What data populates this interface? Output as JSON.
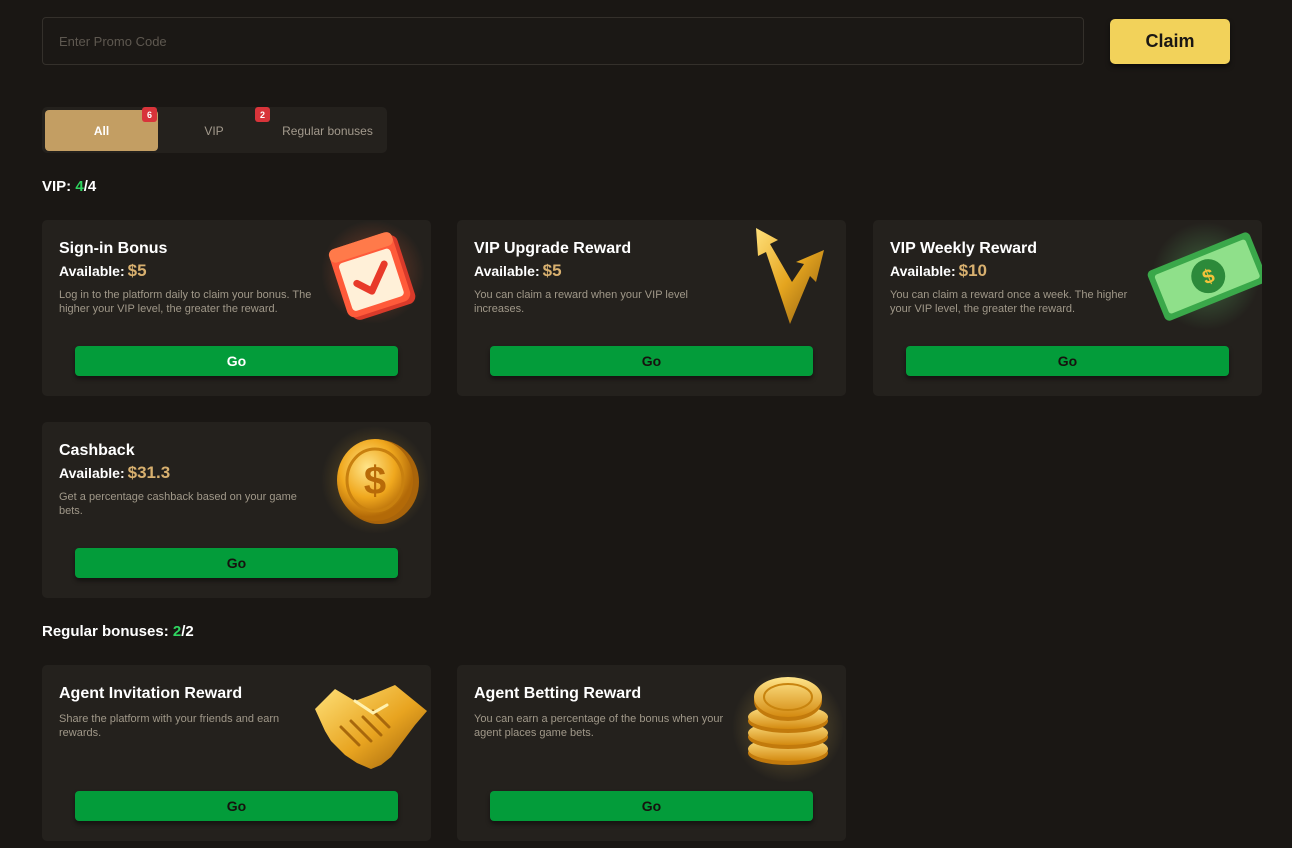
{
  "promo": {
    "placeholder": "Enter Promo Code",
    "claim_label": "Claim"
  },
  "tabs": [
    {
      "label": "All",
      "badge": "6",
      "active": true
    },
    {
      "label": "VIP",
      "badge": "2",
      "active": false
    },
    {
      "label": "Regular bonuses",
      "badge": "",
      "active": false
    }
  ],
  "vip_section": {
    "label": "VIP:",
    "count_done": "4",
    "count_total": "/4",
    "cards": [
      {
        "title": "Sign-in Bonus",
        "available_label": "Available:",
        "amount": "$5",
        "description": "Log in to the platform daily to claim your bonus. The higher your VIP level, the greater the reward.",
        "button": "Go",
        "icon": "calendar-check-icon"
      },
      {
        "title": "VIP Upgrade Reward",
        "available_label": "Available:",
        "amount": "$5",
        "description": "You can claim a reward when your VIP level increases.",
        "button": "Go",
        "icon": "upgrade-arrow-icon"
      },
      {
        "title": "VIP Weekly Reward",
        "available_label": "Available:",
        "amount": "$10",
        "description": "You can claim a reward once a week. The higher your VIP level, the greater the reward.",
        "button": "Go",
        "icon": "cash-banknote-icon"
      },
      {
        "title": "Cashback",
        "available_label": "Available:",
        "amount": "$31.3",
        "description": "Get a percentage cashback based on your game bets.",
        "button": "Go",
        "icon": "gold-coin-icon"
      }
    ]
  },
  "regular_section": {
    "label": "Regular bonuses:",
    "count_done": "2",
    "count_total": "/2",
    "cards": [
      {
        "title": "Agent Invitation Reward",
        "description": "Share the platform with your friends and earn rewards.",
        "button": "Go",
        "icon": "handshake-icon"
      },
      {
        "title": "Agent Betting Reward",
        "description": "You can earn a percentage of the bonus when your agent places game bets.",
        "button": "Go",
        "icon": "coin-stack-icon"
      }
    ]
  },
  "colors": {
    "background": "#1a1714",
    "card": "#24211d",
    "accent_gold": "#f2d25a",
    "tab_active": "#c39e63",
    "go_green": "#039c3a",
    "count_green": "#2fd460",
    "amount_gold": "#d8b06f",
    "badge_red": "#d8343a"
  }
}
